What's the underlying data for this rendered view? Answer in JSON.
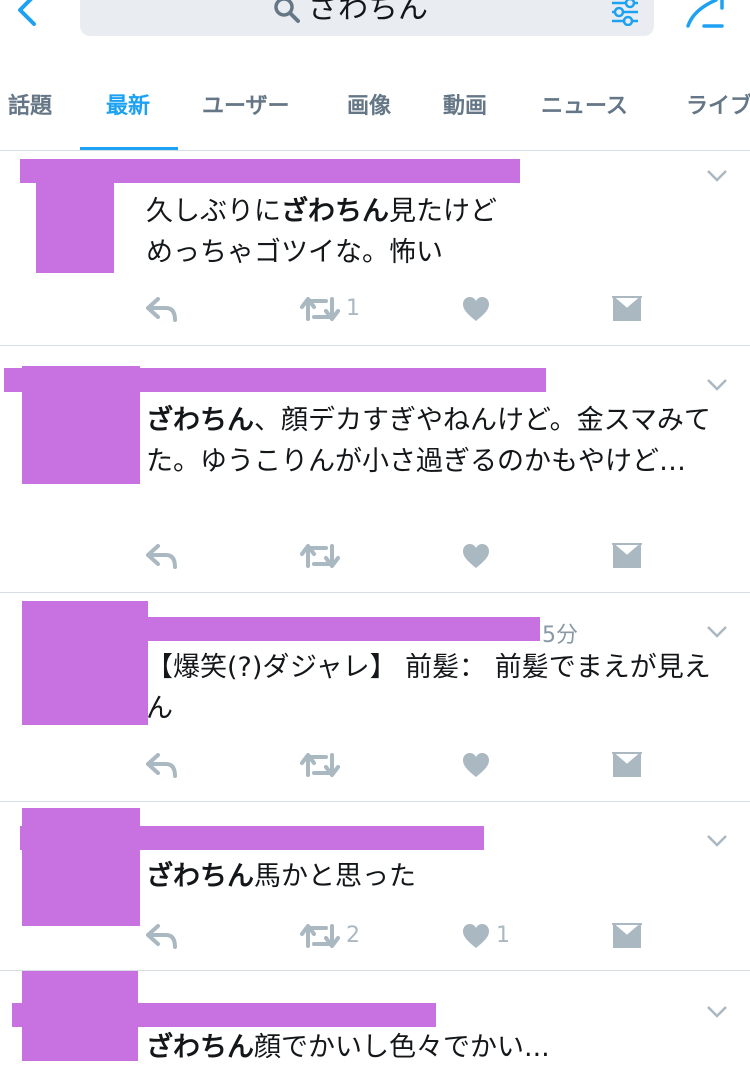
{
  "search": {
    "query": "ざわちん"
  },
  "tabs": [
    {
      "label": "話題"
    },
    {
      "label": "最新"
    },
    {
      "label": "ユーザー"
    },
    {
      "label": "画像"
    },
    {
      "label": "動画"
    },
    {
      "label": "ニュース"
    },
    {
      "label": "ライブ"
    }
  ],
  "tweets": [
    {
      "time": "",
      "segments": [
        "久しぶりに",
        "ざわちん",
        "見たけど\nめっちゃゴツイな。怖い"
      ],
      "retweets": "1",
      "likes": ""
    },
    {
      "time": "",
      "segments": [
        "",
        "ざわちん",
        "、顔デカすぎやねんけど。金スマみてた。ゆうこりんが小さ過ぎるのかもやけど…"
      ],
      "retweets": "",
      "likes": ""
    },
    {
      "time": "5分",
      "segments": [
        "【爆笑(?)ダジャレ】 前髪： 前髪でまえが見えん",
        "",
        ""
      ],
      "retweets": "",
      "likes": ""
    },
    {
      "time": "",
      "segments": [
        "",
        "ざわちん",
        "馬かと思った"
      ],
      "retweets": "2",
      "likes": "1"
    },
    {
      "time": "",
      "segments": [
        "",
        "ざわちん",
        "顔でかいし色々でかい..."
      ],
      "retweets": "",
      "likes": ""
    }
  ],
  "colors": {
    "accent": "#1da1f2",
    "redaction": "#c772e0",
    "icon_gray": "#aab8c2"
  }
}
